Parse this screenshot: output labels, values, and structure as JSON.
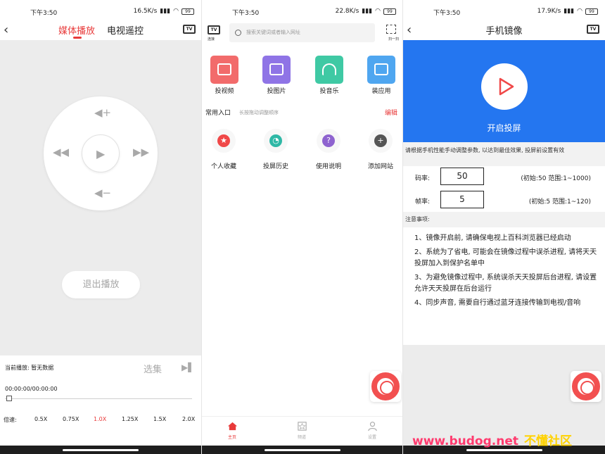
{
  "status_bars": [
    {
      "time": "下午3:50",
      "speed": "16.5K/s",
      "battery": "99"
    },
    {
      "time": "下午3:50",
      "speed": "22.8K/s",
      "battery": "99"
    },
    {
      "time": "下午3:50",
      "speed": "17.9K/s",
      "battery": "99"
    }
  ],
  "media": {
    "tab_media": "媒体播放",
    "tab_remote": "电视遥控",
    "tv_badge": "TV",
    "exit_label": "退出播放",
    "now_playing": "当前播放: 暂无数据",
    "choose_label": "选集",
    "time_display": "00:00:00/00:00:00",
    "speed_label": "倍速:",
    "speeds": [
      "0.5X",
      "0.75X",
      "1.0X",
      "1.25X",
      "1.5X",
      "2.0X"
    ],
    "active_speed_index": 2,
    "accent_color": "#e83a3a"
  },
  "home": {
    "tv_badge": "TV",
    "tv_label": "连接",
    "search_placeholder": "搜索关键词或者输入网址",
    "scan_label": "扫一扫",
    "quick_actions": [
      {
        "label": "投视频",
        "icon": "video-icon",
        "color": "#f26b6b"
      },
      {
        "label": "投图片",
        "icon": "image-icon",
        "color": "#8f74e6"
      },
      {
        "label": "投音乐",
        "icon": "headphones-icon",
        "color": "#3fc9a4"
      },
      {
        "label": "装应用",
        "icon": "box-icon",
        "color": "#4fa6f0"
      }
    ],
    "section_title": "常用入口",
    "section_hint": "长按拖动调整顺序",
    "edit_label": "编辑",
    "shortcuts": [
      {
        "label": "个人收藏",
        "icon": "star-icon",
        "color": "#f04848"
      },
      {
        "label": "投屏历史",
        "icon": "clock-icon",
        "color": "#2fb8a6"
      },
      {
        "label": "使用说明",
        "icon": "question-icon",
        "color": "#8e63cf"
      },
      {
        "label": "添加网站",
        "icon": "plus-icon",
        "color": "#555555"
      }
    ],
    "nav": [
      {
        "label": "主页",
        "active": true
      },
      {
        "label": "频道",
        "active": false
      },
      {
        "label": "设置",
        "active": false
      }
    ]
  },
  "mirror": {
    "title": "手机镜像",
    "tv_badge": "TV",
    "start_label": "开启投屏",
    "hint": "请根据手机性能手动调整参数, 以达到最佳效果, 投屏前设置有效",
    "bitrate_label": "码率:",
    "bitrate_value": "50",
    "bitrate_range": "(初始:50 范围:1~1000)",
    "fps_label": "帧率:",
    "fps_value": "5",
    "fps_range": "(初始:5 范围:1~120)",
    "notice_title": "注意事项:",
    "notes": [
      "1、镜像开启前, 请确保电视上百科浏览器已经启动",
      "2、系统为了省电, 可能会在镜像过程中误杀进程, 请将天天投屏加入到保护名单中",
      "3、为避免镜像过程中, 系统误杀天天投屏后台进程, 请设置允许天天投屏在后台运行",
      "4、同步声音, 需要自行通过蓝牙连接传输到电视/音响"
    ],
    "brand_color": "#2476f0"
  },
  "watermark": {
    "site": "www.budog.net",
    "name": "不懂社区"
  }
}
